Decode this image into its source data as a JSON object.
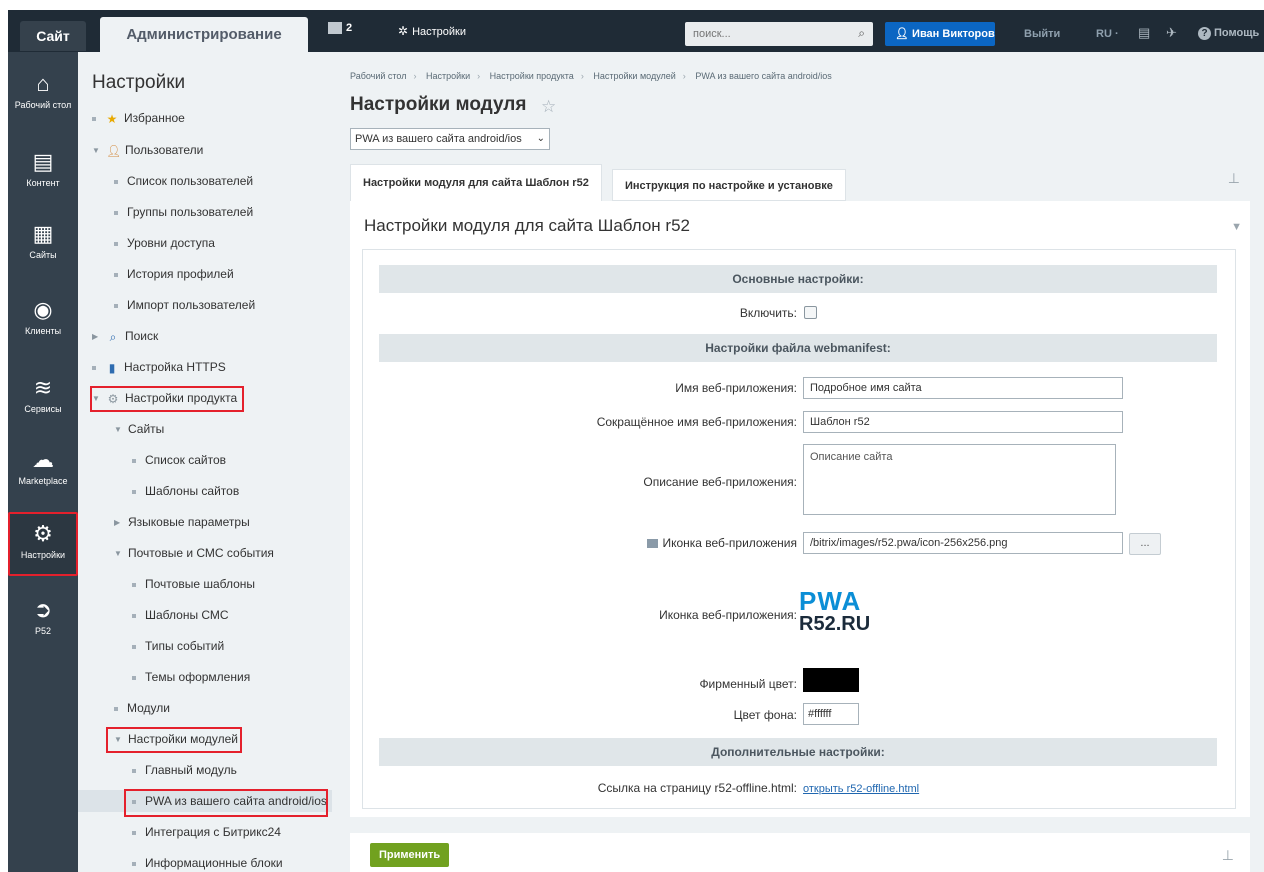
{
  "topbar": {
    "site_tab": "Сайт",
    "admin_tab": "Администрирование",
    "notifications_count": "2",
    "settings_label": "Настройки",
    "search_placeholder": "поиск...",
    "user_name": "Иван Викторов",
    "logout": "Выйти",
    "language": "RU",
    "help": "Помощь"
  },
  "iconbar": [
    {
      "icon": "home-icon",
      "label": "Рабочий стол"
    },
    {
      "icon": "content-icon",
      "label": "Контент"
    },
    {
      "icon": "calendar-icon",
      "label": "Сайты"
    },
    {
      "icon": "clients-icon",
      "label": "Клиенты"
    },
    {
      "icon": "layers-icon",
      "label": "Сервисы"
    },
    {
      "icon": "cloud-download-icon",
      "label": "Marketplace"
    },
    {
      "icon": "gear-icon",
      "label": "Настройки"
    },
    {
      "icon": "arrow-circle-icon",
      "label": "Р52"
    }
  ],
  "menu": {
    "title": "Настройки",
    "items": [
      {
        "label": "Избранное"
      },
      {
        "label": "Пользователи"
      },
      {
        "label": "Список пользователей"
      },
      {
        "label": "Группы пользователей"
      },
      {
        "label": "Уровни доступа"
      },
      {
        "label": "История профилей"
      },
      {
        "label": "Импорт пользователей"
      },
      {
        "label": "Поиск"
      },
      {
        "label": "Настройка HTTPS"
      },
      {
        "label": "Настройки продукта"
      },
      {
        "label": "Сайты"
      },
      {
        "label": "Список сайтов"
      },
      {
        "label": "Шаблоны сайтов"
      },
      {
        "label": "Языковые параметры"
      },
      {
        "label": "Почтовые и СМС события"
      },
      {
        "label": "Почтовые шаблоны"
      },
      {
        "label": "Шаблоны СМС"
      },
      {
        "label": "Типы событий"
      },
      {
        "label": "Темы оформления"
      },
      {
        "label": "Модули"
      },
      {
        "label": "Настройки модулей"
      },
      {
        "label": "Главный модуль"
      },
      {
        "label": "PWA из вашего сайта android/ios"
      },
      {
        "label": "Интеграция с Битрикс24"
      },
      {
        "label": "Информационные блоки"
      }
    ]
  },
  "breadcrumbs": [
    "Рабочий стол",
    "Настройки",
    "Настройки продукта",
    "Настройки модулей",
    "PWA из вашего сайта android/ios"
  ],
  "page_title": "Настройки модуля",
  "module_select": "PWA из вашего сайта android/ios",
  "tabs": [
    {
      "label": "Настройки модуля для сайта Шаблон r52"
    },
    {
      "label": "Инструкция по настройке и установке"
    }
  ],
  "panel": {
    "title": "Настройки модуля для сайта Шаблон r52",
    "section_main": "Основные настройки:",
    "enable_label": "Включить:",
    "section_manifest": "Настройки файла webmanifest:",
    "app_name_label": "Имя веб-приложения:",
    "app_name_value": "Подробное имя сайта",
    "short_name_label": "Сокращённое имя веб-приложения:",
    "short_name_value": "Шаблон r52",
    "description_label": "Описание веб-приложения:",
    "description_value": "Описание сайта",
    "icon_path_label": "Иконка веб-приложения",
    "icon_path_value": "/bitrix/images/r52.pwa/icon-256x256.png",
    "browse_button": "...",
    "icon_preview_label": "Иконка веб-приложения:",
    "logo_line1": "PWA",
    "logo_line2": "R52.RU",
    "brand_color_label": "Фирменный цвет:",
    "brand_color": "#000000",
    "bg_color_label": "Цвет фона:",
    "bg_color_value": "#ffffff",
    "section_extra": "Дополнительные настройки:",
    "offline_label": "Ссылка на страницу r52-offline.html:",
    "offline_link": "открыть r52-offline.html"
  },
  "footer": {
    "apply": "Применить"
  }
}
